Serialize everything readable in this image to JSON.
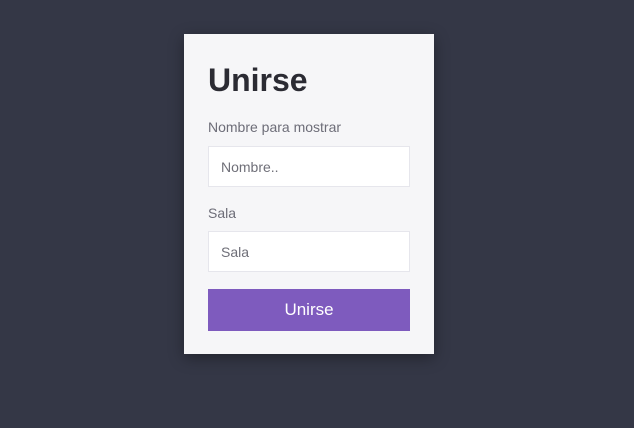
{
  "form": {
    "title": "Unirse",
    "name_label": "Nombre para mostrar",
    "name_placeholder": "Nombre..",
    "name_value": "",
    "room_label": "Sala",
    "room_placeholder": "Sala",
    "room_value": "",
    "submit_label": "Unirse"
  },
  "colors": {
    "background": "#343746",
    "card": "#f6f6f8",
    "button": "#7e5bbe"
  }
}
